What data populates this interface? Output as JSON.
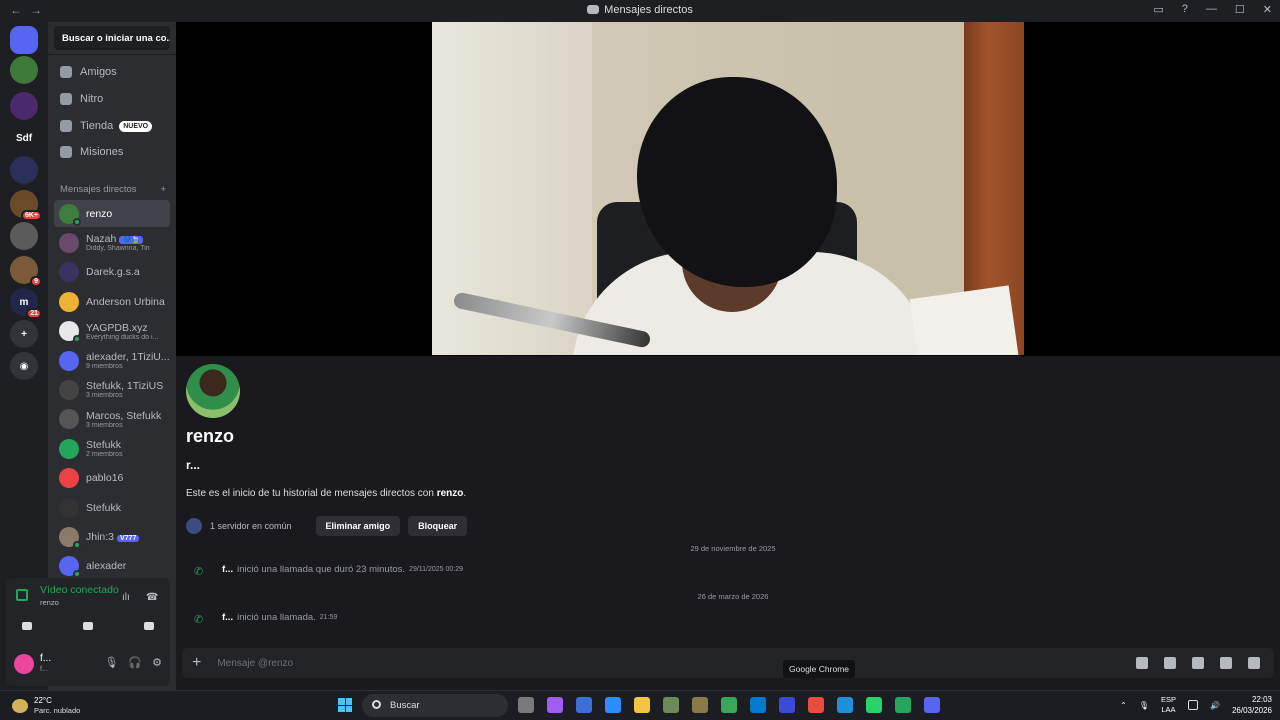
{
  "window": {
    "title": "Mensajes directos",
    "back": "←",
    "forward": "→",
    "controls": [
      "▭",
      "?",
      "—",
      "☐",
      "✕"
    ]
  },
  "servers": [
    {
      "label": "",
      "color": "#5865f2",
      "home": true
    },
    {
      "label": "",
      "color": "#3d7a3a",
      "badge": ""
    },
    {
      "label": "",
      "color": "#4a2a6b"
    },
    {
      "label": "Sdf",
      "color": "#1e1f22"
    },
    {
      "label": "",
      "color": "#2a2f59"
    },
    {
      "label": "",
      "color": "#6b4a2a",
      "badge": "6K+"
    },
    {
      "label": "",
      "color": "#5b5b5b"
    },
    {
      "label": "",
      "color": "#7a5a3a",
      "badge": "9"
    },
    {
      "label": "m",
      "color": "#20274b",
      "badge": "21"
    },
    {
      "label": "+",
      "color": "#313338"
    },
    {
      "label": "◉",
      "color": "#313338"
    }
  ],
  "sidebar": {
    "search_label": "Buscar o iniciar una co...",
    "nav": [
      {
        "label": "Amigos",
        "tag": ""
      },
      {
        "label": "Nitro",
        "tag": ""
      },
      {
        "label": "Tienda",
        "tag": "NUEVO"
      },
      {
        "label": "Misiones",
        "tag": ""
      }
    ],
    "dm_header": "Mensajes directos",
    "dm_add": "+",
    "dms": [
      {
        "name": "renzo",
        "sub": "",
        "tag": "",
        "color": "#3e7d3f",
        "selected": true,
        "online": true
      },
      {
        "name": "Nazah",
        "sub": "Diddy, Shawnna, Tin",
        "tag": "💙🍃",
        "color": "#6a4a6b",
        "online": false
      },
      {
        "name": "Darek.g.s.a",
        "sub": "",
        "tag": "",
        "color": "#3a3360",
        "online": false
      },
      {
        "name": "Anderson Urbina",
        "sub": "",
        "tag": "",
        "color": "#f0b232",
        "online": false
      },
      {
        "name": "YAGPDB.xyz",
        "sub": "Everything ducks do i...",
        "tag": "",
        "color": "#e8e8e8",
        "online": true
      },
      {
        "name": "alexader, 1TiziU...",
        "sub": "9 miembros",
        "tag": "",
        "color": "#5865f2",
        "online": false
      },
      {
        "name": "Stefukk, 1TiziUS",
        "sub": "3 miembros",
        "tag": "",
        "color": "#444",
        "online": false
      },
      {
        "name": "Marcos, Stefukk",
        "sub": "3 miembros",
        "tag": "",
        "color": "#555",
        "online": false
      },
      {
        "name": "Stefukk",
        "sub": "2 miembros",
        "tag": "",
        "color": "#23a55a",
        "online": false
      },
      {
        "name": "pablo16",
        "sub": "",
        "tag": "",
        "color": "#ed4245",
        "online": false
      },
      {
        "name": "Stefukk",
        "sub": "",
        "tag": "",
        "color": "#333",
        "online": false
      },
      {
        "name": "Jhin:3",
        "sub": "",
        "tag": "V777",
        "color": "#8a7a6a",
        "online": true
      },
      {
        "name": "alexader",
        "sub": "",
        "tag": "",
        "color": "#5865f2",
        "online": true
      }
    ]
  },
  "voice": {
    "status": "Vídeo conectado",
    "channel": "renzo"
  },
  "user": {
    "name": "f...",
    "status": "f...",
    "color": "#eb459e"
  },
  "chat": {
    "username": "renzo",
    "handle": "r...",
    "intro_prefix": "Este es el inicio de tu historial de mensajes directos con ",
    "intro_name": "renzo",
    "intro_suffix": ".",
    "mutual": "1 servidor en común",
    "remove_friend": "Eliminar amigo",
    "block": "Bloquear",
    "events": [
      {
        "date": "29 de noviembre de 2025",
        "who": "f...",
        "text": "inició una llamada que duró 23 minutos.",
        "ts": "29/11/2025 00:29"
      },
      {
        "date": "26 de marzo de 2026",
        "who": "f...",
        "text": "inició una llamada.",
        "ts": "21:59"
      }
    ],
    "placeholder": "Mensaje @renzo",
    "tooltip": "Google Chrome"
  },
  "taskbar": {
    "temp": "22°C",
    "weather": "Parc. nublado",
    "search": "Buscar",
    "apps": [
      "#7a7a7a",
      "#a35cf2",
      "#3b6fd6",
      "#2d8cff",
      "#f3c343",
      "#6d8b5a",
      "#8a7a4a",
      "#3ba55c",
      "#007acc",
      "#3b4bd6",
      "#e74c3c",
      "#1e8fd8",
      "#25d366",
      "#26a65b",
      "#5865f2"
    ],
    "lang1": "ESP",
    "lang2": "LAA",
    "time": "22:03",
    "date": "26/03/2026"
  }
}
